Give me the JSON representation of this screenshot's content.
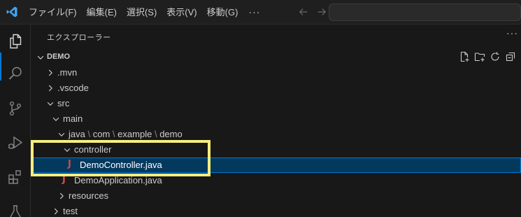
{
  "menu": {
    "items": [
      "ファイル(F)",
      "編集(E)",
      "選択(S)",
      "表示(V)",
      "移動(G)"
    ],
    "more": "···"
  },
  "sidebar": {
    "title": "エクスプローラー",
    "more": "···",
    "section_label": "DEMO"
  },
  "tree": {
    "mvn": ".mvn",
    "vscode": ".vscode",
    "src": "src",
    "main": "main",
    "java_path": {
      "java": "java",
      "com": "com",
      "example": "example",
      "demo": "demo",
      "sep": "\\"
    },
    "controller": "controller",
    "democontroller": "DemoController.java",
    "demoapplication": "DemoApplication.java",
    "resources": "resources",
    "test": "test",
    "java_glyph": "J"
  },
  "colors": {
    "accent": "#0078d4",
    "selection": "#04395e",
    "java": "#d44b43",
    "highlight": "#f7ee7f"
  }
}
